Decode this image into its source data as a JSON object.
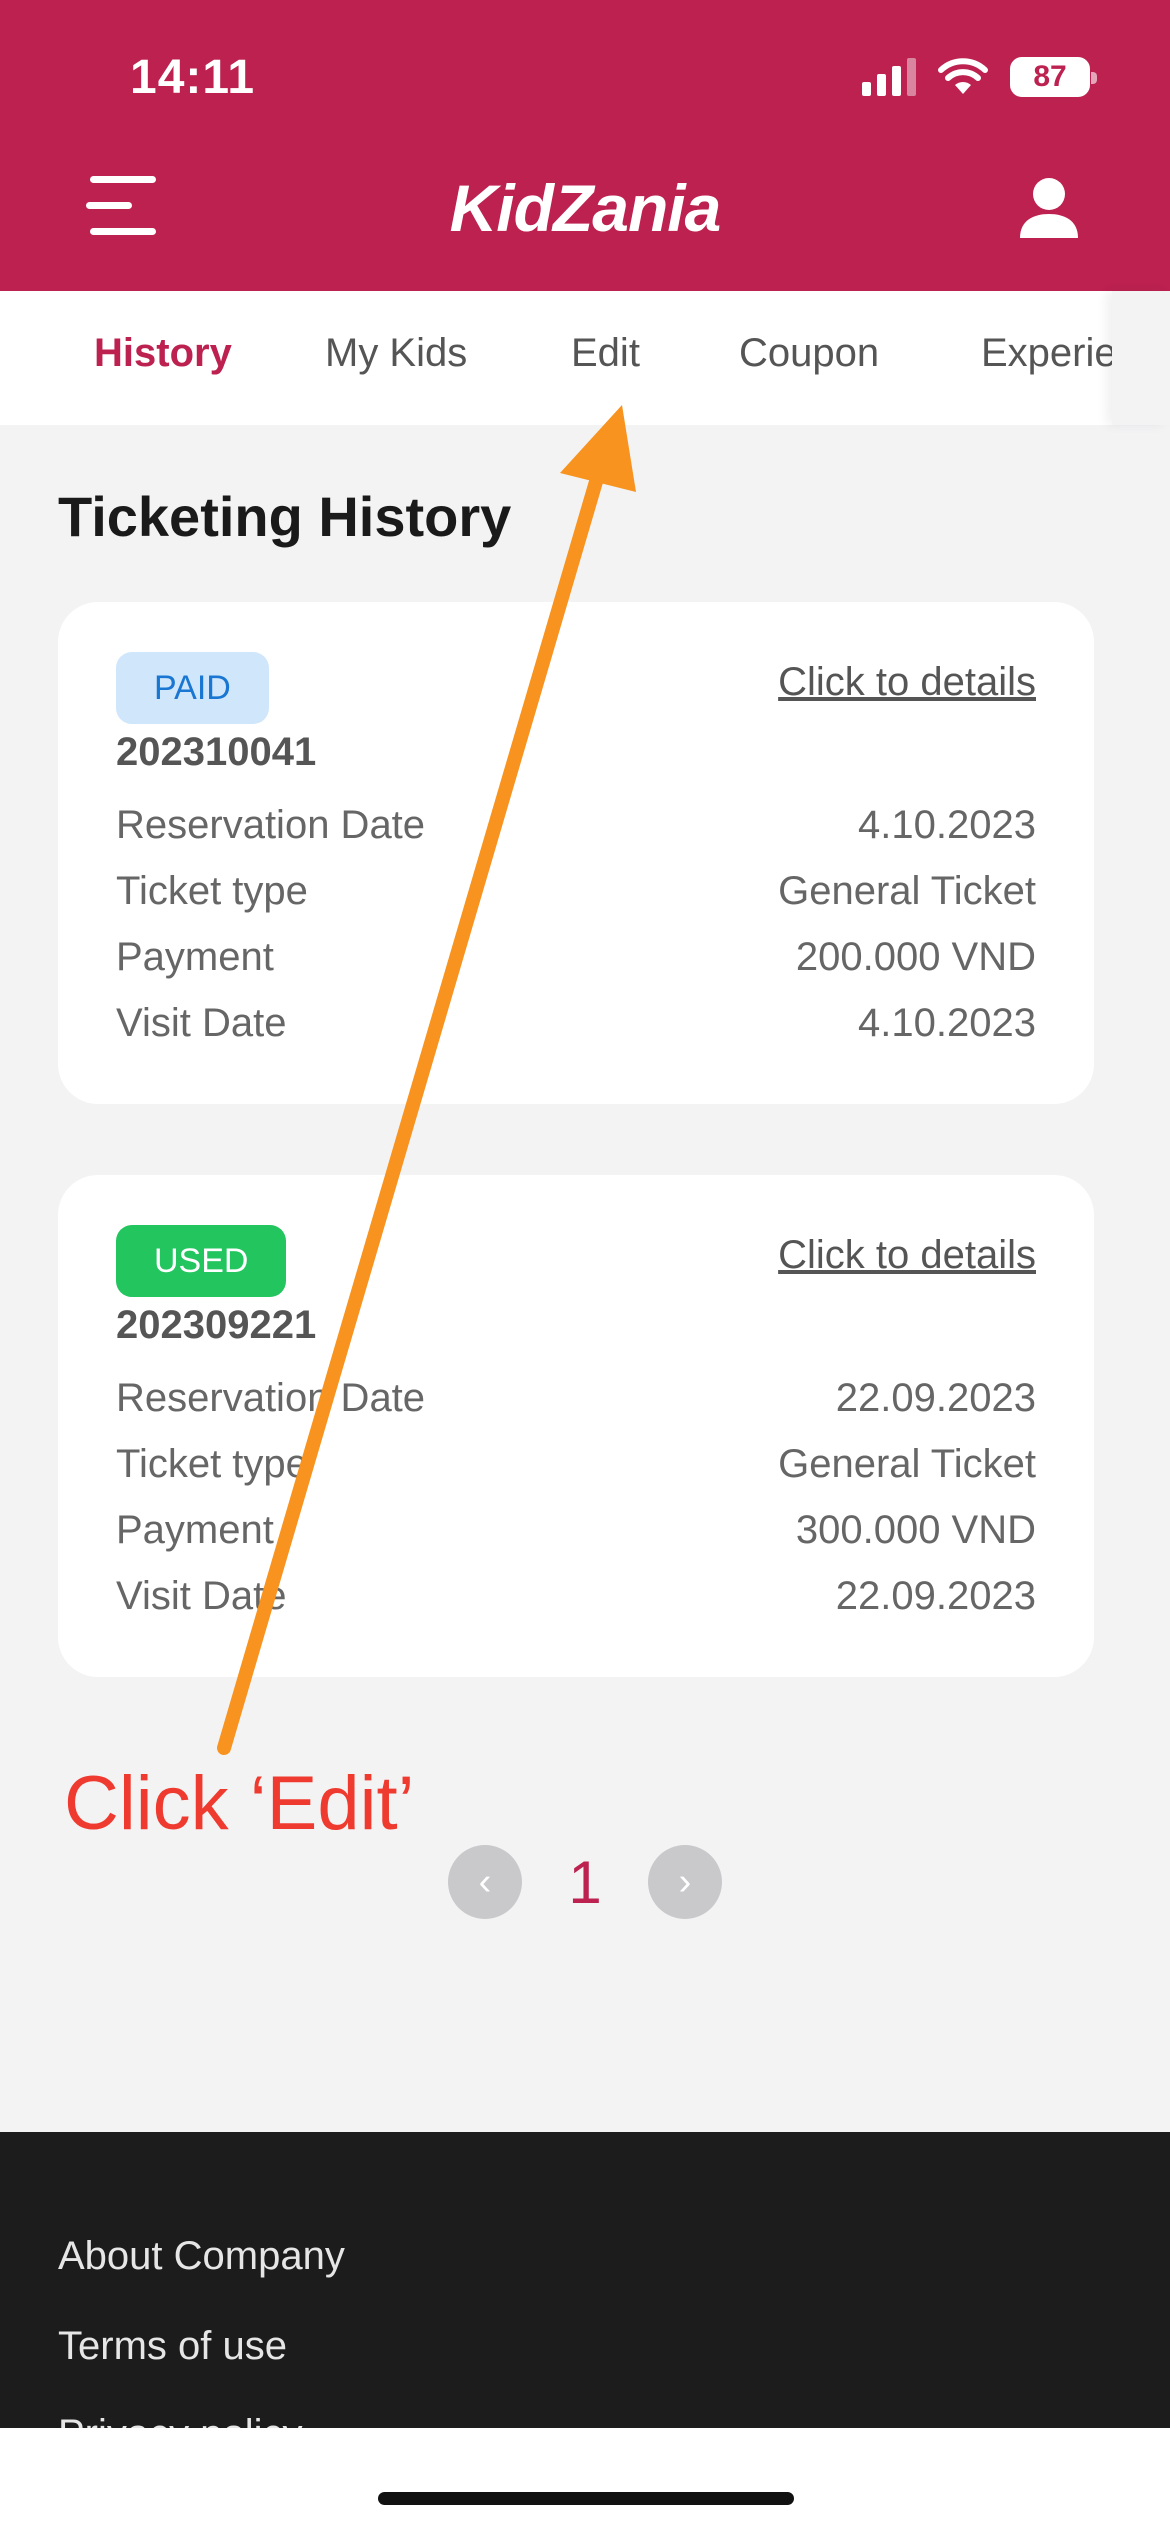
{
  "status_bar": {
    "time": "14:11",
    "battery": "87"
  },
  "header": {
    "logo": "KidZania"
  },
  "tabs": [
    {
      "label": "History",
      "active": true
    },
    {
      "label": "My Kids",
      "active": false
    },
    {
      "label": "Edit",
      "active": false
    },
    {
      "label": "Coupon",
      "active": false
    },
    {
      "label": "Experie",
      "active": false
    }
  ],
  "page": {
    "title": "Ticketing History"
  },
  "tickets": [
    {
      "status": "PAID",
      "number": "202310041",
      "details_link": "Click to details",
      "rows": [
        {
          "label": "Reservation Date",
          "value": "4.10.2023"
        },
        {
          "label": "Ticket type",
          "value": "General Ticket"
        },
        {
          "label": "Payment",
          "value": "200.000 VND"
        },
        {
          "label": "Visit Date",
          "value": "4.10.2023"
        }
      ]
    },
    {
      "status": "USED",
      "number": "202309221",
      "details_link": "Click to details",
      "rows": [
        {
          "label": "Reservation Date",
          "value": "22.09.2023"
        },
        {
          "label": "Ticket type",
          "value": "General Ticket"
        },
        {
          "label": "Payment",
          "value": "300.000 VND"
        },
        {
          "label": "Visit Date",
          "value": "22.09.2023"
        }
      ]
    }
  ],
  "annotation": {
    "text": "Click ‘Edit’",
    "text_color": "#ef3b2f",
    "arrow_color": "#f7931e"
  },
  "pagination": {
    "prev": "‹",
    "current": "1",
    "next": "›"
  },
  "footer": {
    "links": [
      "About Company",
      "Terms of use",
      "Privacy policy"
    ]
  },
  "colors": {
    "brand": "#bc2150",
    "paid_badge": "#cfe6fb",
    "used_badge": "#22c55e",
    "footer_bg": "#1c1c1c"
  }
}
